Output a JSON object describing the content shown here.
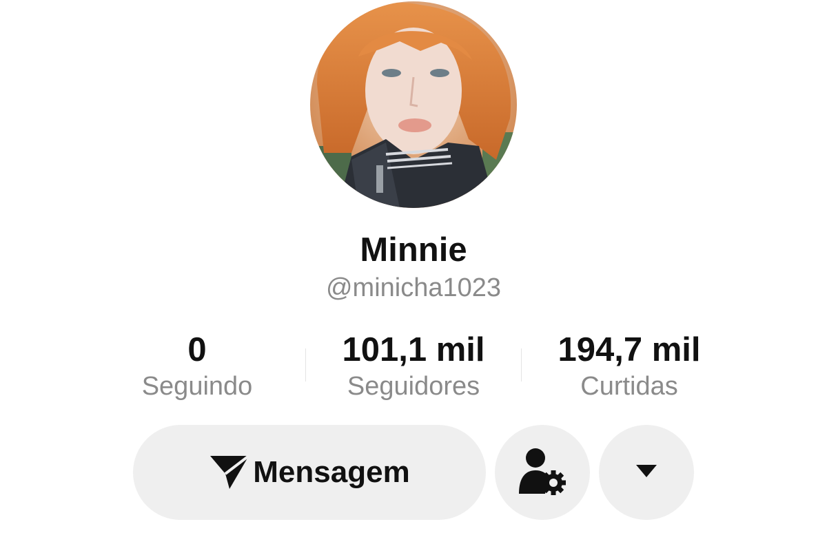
{
  "profile": {
    "display_name": "Minnie",
    "handle": "@minicha1023",
    "avatar_alt": "avatar"
  },
  "stats": [
    {
      "value": "0",
      "label": "Seguindo"
    },
    {
      "value": "101,1 mil",
      "label": "Seguidores"
    },
    {
      "value": "194,7 mil",
      "label": "Curtidas"
    }
  ],
  "actions": {
    "message_label": "Mensagem",
    "message_icon": "send-icon",
    "settings_icon": "user-gear-icon",
    "dropdown_icon": "caret-down-icon"
  },
  "colors": {
    "text_primary": "#111111",
    "text_secondary": "#8a8a8a",
    "button_bg": "#efefef",
    "background": "#ffffff"
  }
}
